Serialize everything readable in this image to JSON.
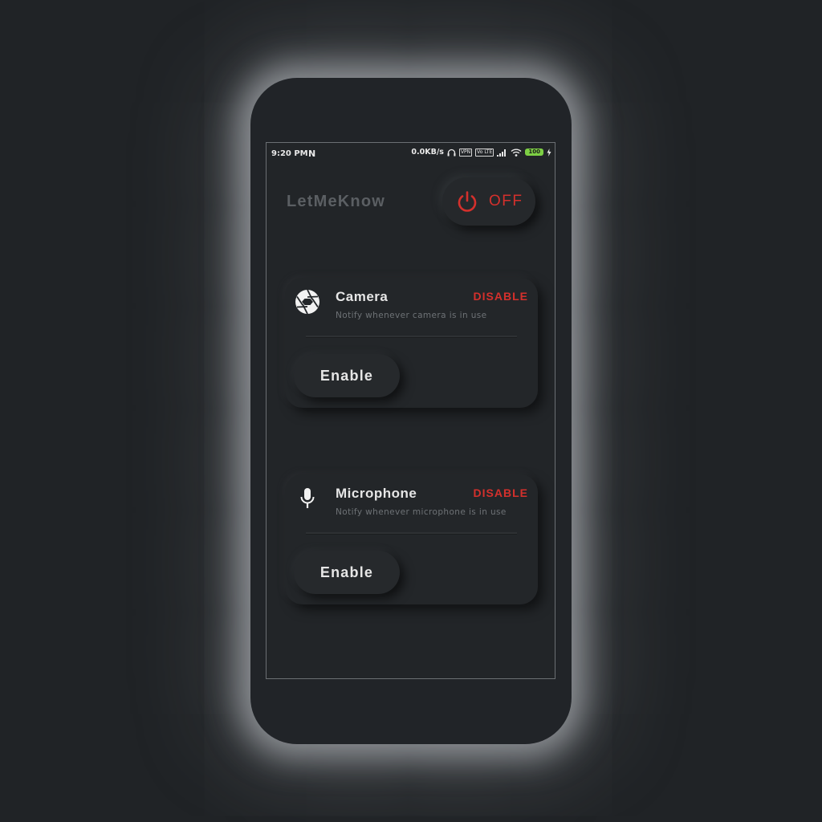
{
  "status_bar": {
    "time": "9:20 PM",
    "notification_glyph": "N",
    "net_speed": "0.0KB/s",
    "vpn_label": "VPN",
    "volte_label": "Vo LTE",
    "battery": "100"
  },
  "header": {
    "app_title": "LetMeKnow",
    "power_state": "OFF"
  },
  "cards": [
    {
      "id": "camera",
      "title": "Camera",
      "description": "Notify whenever camera is in use",
      "disable_label": "DISABLE",
      "enable_label": "Enable",
      "icon": "camera-aperture-icon"
    },
    {
      "id": "microphone",
      "title": "Microphone",
      "description": "Notify whenever microphone is in use",
      "disable_label": "DISABLE",
      "enable_label": "Enable",
      "icon": "microphone-icon"
    }
  ],
  "colors": {
    "background": "#202326",
    "accent_red": "#d4302c",
    "text_primary": "#e6e6e6",
    "text_muted": "#6e7276",
    "title_muted": "#5b5f63",
    "battery_green": "#7dcf44"
  }
}
